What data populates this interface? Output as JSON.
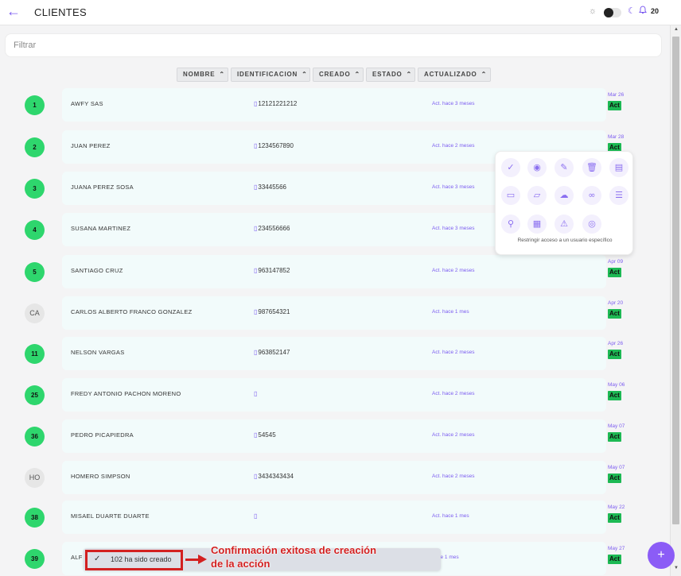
{
  "header": {
    "back_icon": "←",
    "title": "CLIENTES",
    "sun_icon": "☼",
    "moon_icon": "☾",
    "bell_icon": "♫",
    "notifications": "20"
  },
  "filter": {
    "placeholder": "Filtrar"
  },
  "columns": [
    {
      "label": "NOMBRE",
      "chev": "⌃"
    },
    {
      "label": "IDENTIFICACION",
      "chev": "⌃"
    },
    {
      "label": "CREADO",
      "chev": "⌃"
    },
    {
      "label": "ESTADO",
      "chev": "⌃"
    },
    {
      "label": "ACTUALIZADO",
      "chev": "⌃"
    }
  ],
  "clients": [
    {
      "badge": "1",
      "name": "AWFY SAS",
      "ident": "12121221212",
      "updated": "Act. hace 3 meses",
      "date": "Mar 26",
      "status": "Act"
    },
    {
      "badge": "2",
      "name": "JUAN PEREZ",
      "ident": "1234567890",
      "updated": "Act. hace 2 meses",
      "date": "Mar 28",
      "status": "Act"
    },
    {
      "badge": "3",
      "name": "JUANA PEREZ SOSA",
      "ident": "33445566",
      "updated": "Act. hace 3 meses",
      "date": "",
      "status": ""
    },
    {
      "badge": "4",
      "name": "SUSANA MARTINEZ",
      "ident": "234556666",
      "updated": "Act. hace 3 meses",
      "date": "",
      "status": ""
    },
    {
      "badge": "5",
      "name": "SANTIAGO CRUZ",
      "ident": "963147852",
      "updated": "Act. hace 2 meses",
      "date": "Apr 09",
      "status": "Act"
    },
    {
      "badge": "CA",
      "name": "CARLOS ALBERTO FRANCO GONZALEZ",
      "ident": "987654321",
      "updated": "Act. hace 1 mes",
      "date": "Apr 20",
      "status": "Act"
    },
    {
      "badge": "11",
      "name": "NELSON VARGAS",
      "ident": "963852147",
      "updated": "Act. hace 2 meses",
      "date": "Apr 26",
      "status": "Act"
    },
    {
      "badge": "25",
      "name": "FREDY ANTONIO PACHON MORENO",
      "ident": "",
      "updated": "Act. hace 2 meses",
      "date": "May 06",
      "status": "Act"
    },
    {
      "badge": "36",
      "name": "PEDRO PICAPIEDRA",
      "ident": "54545",
      "updated": "Act. hace 2 meses",
      "date": "May 07",
      "status": "Act"
    },
    {
      "badge": "HO",
      "name": "HOMERO SIMPSON",
      "ident": "3434343434",
      "updated": "Act. hace 2 meses",
      "date": "May 07",
      "status": "Act"
    },
    {
      "badge": "38",
      "name": "MISAEL DUARTE DUARTE",
      "ident": "",
      "updated": "Act. hace 1 mes",
      "date": "May 22",
      "status": "Act"
    },
    {
      "badge": "39",
      "name": "ALF",
      "ident": "",
      "updated": "hace 1 mes",
      "date": "May 27",
      "status": "Act"
    }
  ],
  "ident_icon": "▯",
  "actions": {
    "row1": [
      {
        "icon": "check-icon",
        "glyph": "✓"
      },
      {
        "icon": "eye-icon",
        "glyph": "◉"
      },
      {
        "icon": "edit-icon",
        "glyph": "✎"
      },
      {
        "icon": "trash-icon",
        "glyph": "🗑"
      },
      {
        "icon": "document-icon",
        "glyph": "▤"
      }
    ],
    "row2": [
      {
        "icon": "comment-icon",
        "glyph": "▭"
      },
      {
        "icon": "folder-icon",
        "glyph": "▱"
      },
      {
        "icon": "cloud-upload-icon",
        "glyph": "☁"
      },
      {
        "icon": "glasses-icon",
        "glyph": "∞"
      },
      {
        "icon": "list-icon",
        "glyph": "☰"
      }
    ],
    "row3": [
      {
        "icon": "user-add-icon",
        "glyph": "⚲"
      },
      {
        "icon": "receipt-icon",
        "glyph": "▦"
      },
      {
        "icon": "warning-icon",
        "glyph": "⚠"
      },
      {
        "icon": "user-circle-icon",
        "glyph": "◎"
      }
    ],
    "hint": "Restringir acceso a un usuario específico"
  },
  "toast": {
    "check_icon": "✓",
    "message": "102 ha sido creado"
  },
  "annotation": {
    "line1": "Confirmación exitosa de creación",
    "line2": "de la acción",
    "color": "#d32020"
  },
  "fab_icon": "+",
  "colors": {
    "accent": "#7c5cf0",
    "badge_green": "#2ed66d",
    "status_green": "#1db954",
    "card_bg": "#f2fbfb"
  }
}
